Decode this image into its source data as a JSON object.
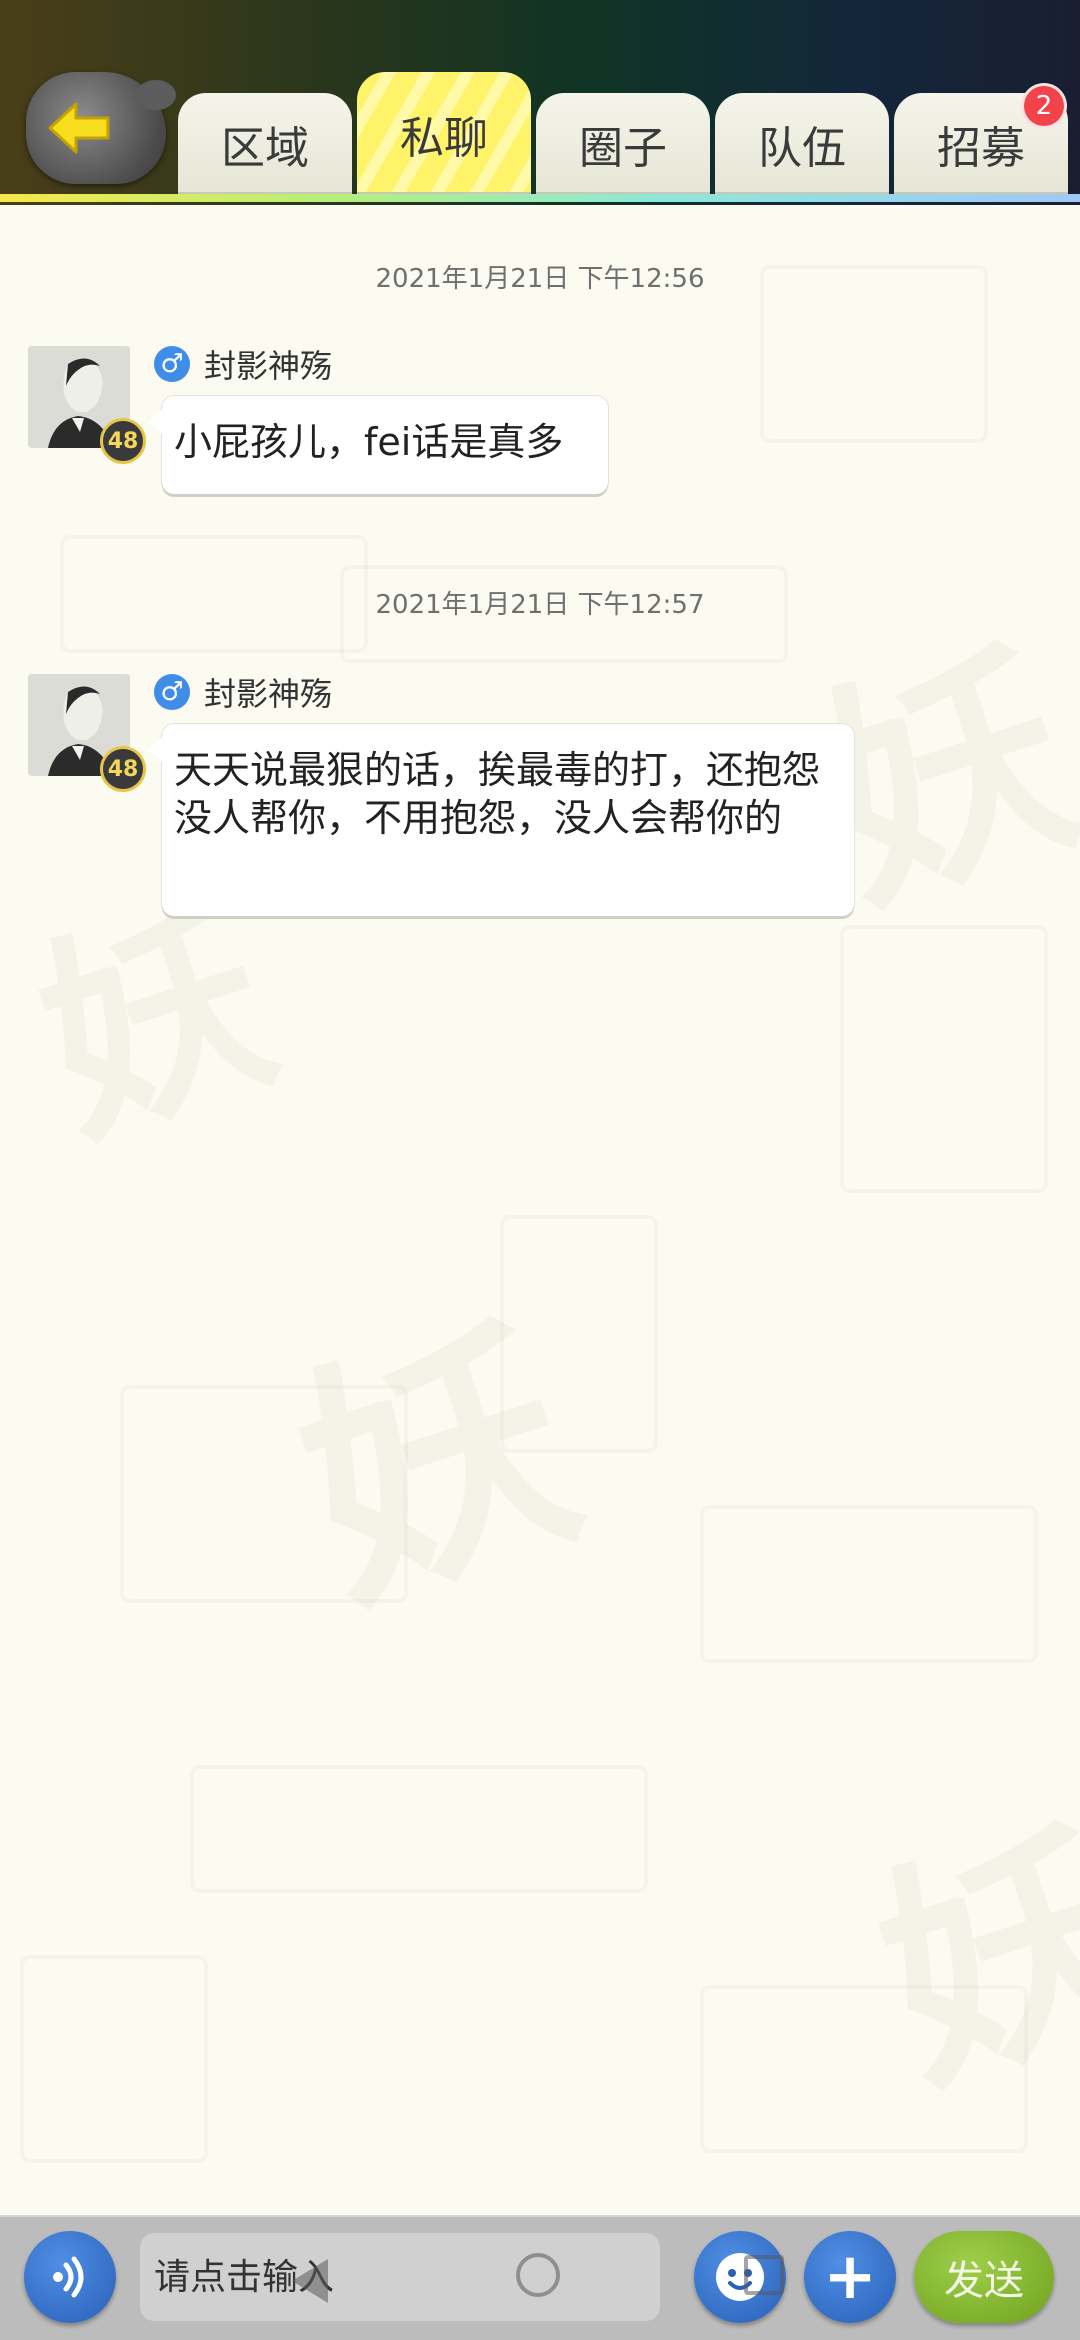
{
  "header": {
    "tabs": [
      {
        "label": "区域",
        "active": false
      },
      {
        "label": "私聊",
        "active": true
      },
      {
        "label": "圈子",
        "active": false
      },
      {
        "label": "队伍",
        "active": false
      },
      {
        "label": "招募",
        "active": false
      }
    ],
    "recruit_badge": "2"
  },
  "messages": [
    {
      "timestamp": "2021年1月21日 下午12:56",
      "sender": "封影神殇",
      "gender": "♂",
      "level": "48",
      "text": "小屁孩儿，fei话是真多"
    },
    {
      "timestamp": "2021年1月21日 下午12:57",
      "sender": "封影神殇",
      "gender": "♂",
      "level": "48",
      "text": "天天说最狠的话，挨最毒的打，还抱怨没人帮你，不用抱怨，没人会帮你的"
    }
  ],
  "input_bar": {
    "placeholder": "请点击输入",
    "send_label": "发送",
    "plus_label": "+"
  },
  "colors": {
    "active_tab": "#fff36a",
    "badge": "#f2424a",
    "gender_male": "#3f8de6",
    "send_button": "#8cbf33",
    "round_buttons": "#3a75cf"
  }
}
